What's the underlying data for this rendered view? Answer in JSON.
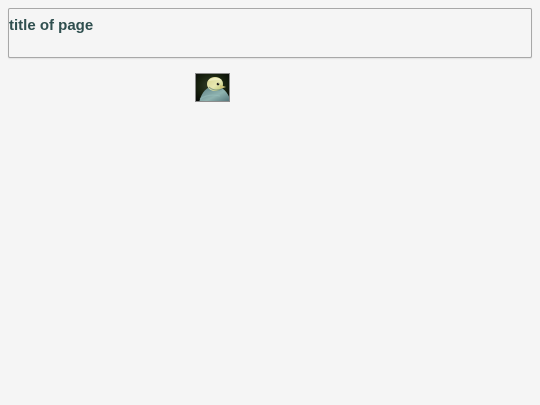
{
  "header": {
    "title": "title of page"
  },
  "image": {
    "icon": "bird-photo-icon"
  },
  "colors": {
    "background": "#f5f5f5",
    "title": "#2f4f4f",
    "border": "#a8a8a8"
  }
}
